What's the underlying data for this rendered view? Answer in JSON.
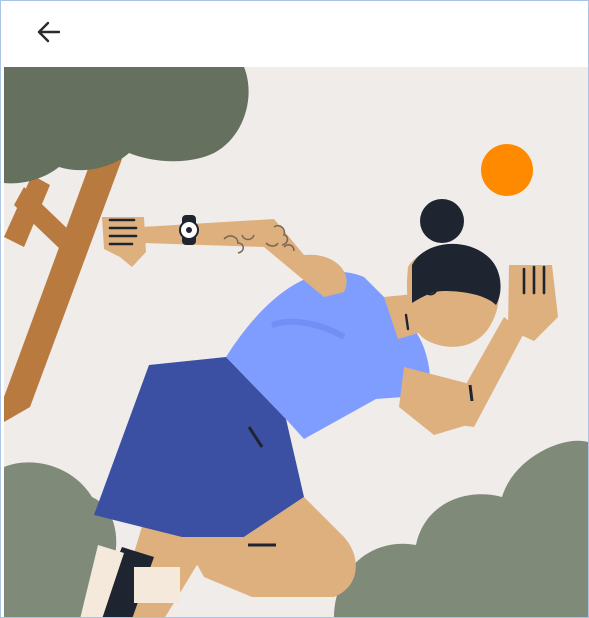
{
  "app_bar": {
    "back_icon": "arrow-left-icon"
  },
  "illustration": {
    "subject": "runner-illustration",
    "colors": {
      "background": "#efecea",
      "tree_foliage": "#66705f",
      "tree_trunk": "#b87a3e",
      "bush": "#7f8a78",
      "sun": "#ff8a00",
      "skin": "#deb07e",
      "shirt": "#7f9cff",
      "shorts": "#3b4fa3",
      "hair": "#1f2530",
      "shoe": "#1f2530",
      "sock": "#f5e9dc"
    }
  }
}
